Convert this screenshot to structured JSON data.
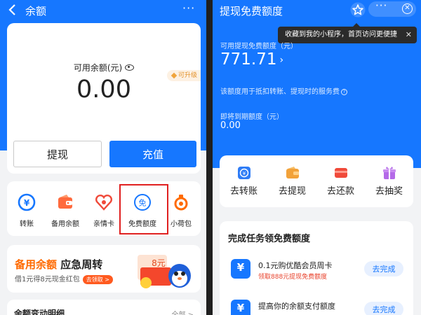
{
  "left": {
    "header": {
      "title": "余额",
      "back_icon": "back-chevron-icon",
      "more_label": "···"
    },
    "balance": {
      "label": "可用余额(元)",
      "value": "0.00",
      "badge": "可升级"
    },
    "buttons": {
      "withdraw": "提现",
      "recharge": "充值"
    },
    "quick_items": [
      {
        "label": "转账",
        "icon": "transfer-icon"
      },
      {
        "label": "备用余额",
        "icon": "wallet-icon"
      },
      {
        "label": "亲情卡",
        "icon": "family-card-icon"
      },
      {
        "label": "免费额度",
        "icon": "free-quota-icon"
      },
      {
        "label": "小荷包",
        "icon": "pouch-icon"
      }
    ],
    "promo": {
      "title_orange": "备用余额",
      "title_dark": "应急周转",
      "subtitle": "借1元得8元现金红包",
      "pill": "去领取 >",
      "amount": "8元"
    },
    "changes": {
      "title": "余额变动明细",
      "all": "全部 >"
    }
  },
  "right": {
    "header": {
      "title": "提现免费额度",
      "more_label": "···"
    },
    "tooltip": {
      "text": "收藏到我的小程序，首页访问更便捷",
      "close": "✕"
    },
    "available_label": "可用提现免费额度（元）",
    "available_value": "771.71",
    "note": "该额度用于抵扣转账、提现时的服务费",
    "expiring_label": "即将到期额度（元）",
    "expiring_value": "0.00",
    "actions": [
      {
        "label": "去转账",
        "icon": "transfer-icon"
      },
      {
        "label": "去提现",
        "icon": "wallet-icon"
      },
      {
        "label": "去还款",
        "icon": "card-icon"
      },
      {
        "label": "去抽奖",
        "icon": "gift-icon"
      }
    ],
    "tasks": {
      "title": "完成任务领免费额度",
      "items": [
        {
          "title": "0.1元购优酷会员周卡",
          "subtitle": "领取888元提现免费额度",
          "button": "去完成"
        },
        {
          "title": "提高你的余额支付额度",
          "subtitle": "",
          "button": "去完成"
        }
      ]
    }
  },
  "colors": {
    "brand_blue": "#1677ff",
    "orange": "#ff6a00",
    "red_highlight": "#e02020"
  }
}
